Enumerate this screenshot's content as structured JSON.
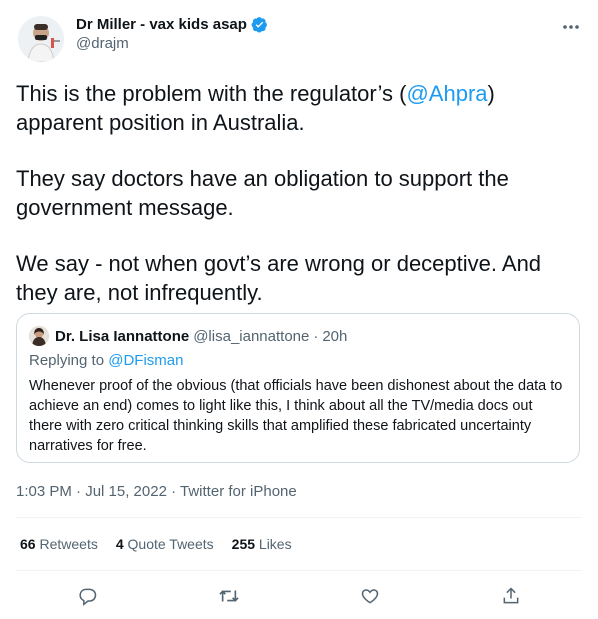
{
  "author": {
    "display_name": "Dr Miller - vax kids asap",
    "handle": "@drajm"
  },
  "tweet": {
    "line1_pre": "This is the problem with the regulator’s (",
    "line1_mention": "@Ahpra",
    "line1_post": ")",
    "line1_cont": "apparent position in Australia.",
    "para2": "They say doctors have an obligation to support the government message.",
    "para3": "We say - not when govt’s are wrong or deceptive. And they are, not infrequently."
  },
  "quote": {
    "display_name": "Dr. Lisa Iannattone",
    "handle": "@lisa_iannattone",
    "dot": "·",
    "time": "20h",
    "replying_label": "Replying to",
    "replying_to": "@DFisman",
    "text": "Whenever proof of the obvious (that officials have been dishonest about the data to achieve an end) comes to light like this, I think about all the TV/media docs out there with zero critical thinking skills that amplified these fabricated uncertainty narratives for free."
  },
  "meta": {
    "time": "1:03 PM · Jul 15, 2022",
    "dot": "·",
    "source": "Twitter for iPhone"
  },
  "stats": {
    "retweets_count": "66",
    "retweets_label": "Retweets",
    "quotes_count": "4",
    "quotes_label": "Quote Tweets",
    "likes_count": "255",
    "likes_label": "Likes"
  },
  "colors": {
    "accent": "#1d9bf0",
    "secondary_text": "#536471",
    "border": "#cfd9de"
  },
  "icons": [
    "verified-badge-icon",
    "more-icon",
    "reply-icon",
    "retweet-icon",
    "like-icon",
    "share-icon"
  ]
}
